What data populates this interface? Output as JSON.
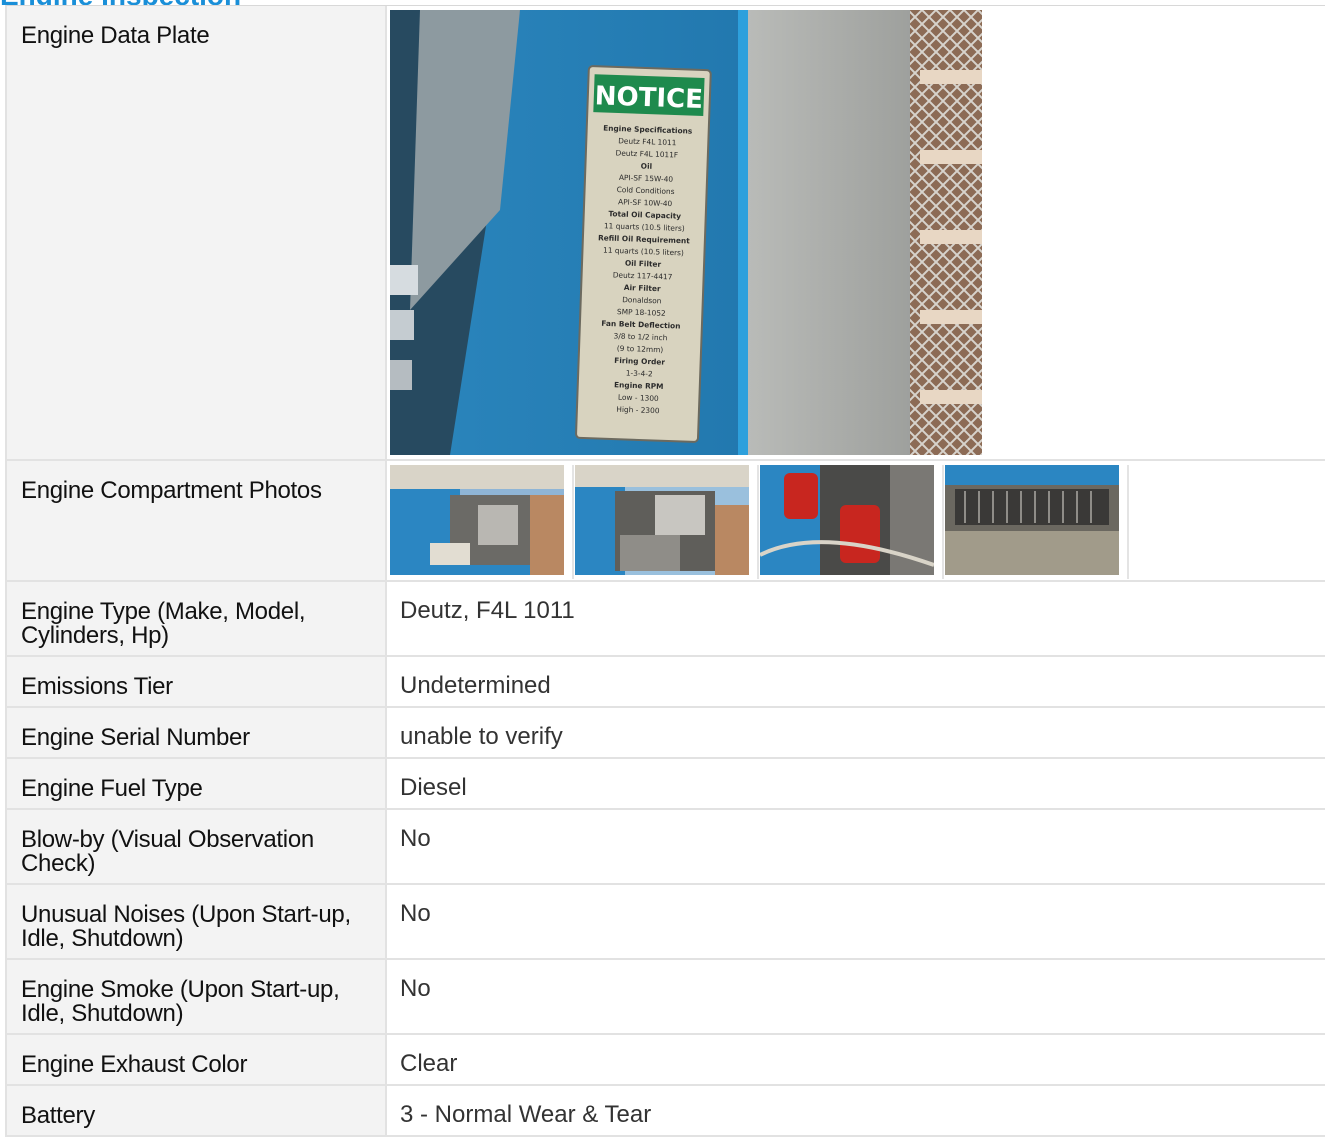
{
  "section": {
    "title": "Engine Inspection"
  },
  "rows": [
    {
      "label": "Engine Data Plate",
      "type": "photo"
    },
    {
      "label": "Engine Compartment Photos",
      "type": "thumbs"
    },
    {
      "label": "Engine Type (Make, Model, Cylinders, Hp)",
      "value": "Deutz, F4L 1011"
    },
    {
      "label": "Emissions Tier",
      "value": "Undetermined"
    },
    {
      "label": "Engine Serial Number",
      "value": "unable to verify"
    },
    {
      "label": "Engine Fuel Type",
      "value": "Diesel"
    },
    {
      "label": "Blow-by (Visual Observation Check)",
      "value": "No"
    },
    {
      "label": "Unusual Noises (Upon Start-up, Idle, Shutdown)",
      "value": "No"
    },
    {
      "label": "Engine Smoke (Upon Start-up, Idle, Shutdown)",
      "value": "No"
    },
    {
      "label": "Engine Exhaust Color",
      "value": "Clear"
    },
    {
      "label": "Battery",
      "value": "3 - Normal Wear & Tear"
    }
  ],
  "data_plate": {
    "heading": "NOTICE",
    "lines": [
      "Engine Specifications",
      "Deutz F4L 1011",
      "Deutz F4L 1011F",
      "Oil",
      "API-SF 15W-40",
      "Cold Conditions",
      "API-SF 10W-40",
      "Total Oil Capacity",
      "11 quarts (10.5 liters)",
      "Refill Oil Requirement",
      "11 quarts (10.5 liters)",
      "Oil Filter",
      "Deutz 117-4417",
      "Air Filter",
      "Donaldson",
      "SMP 18-1052",
      "Fan Belt Deflection",
      "3/8 to 1/2 inch",
      "(9 to 12mm)",
      "Firing Order",
      "1-3-4-2",
      "Engine RPM",
      "Low - 1300",
      "High - 2300"
    ]
  },
  "colors": {
    "accent": "#1a8fd8",
    "panel_blue": "#1f7fb8",
    "label_bg": "#f3f3f3"
  }
}
